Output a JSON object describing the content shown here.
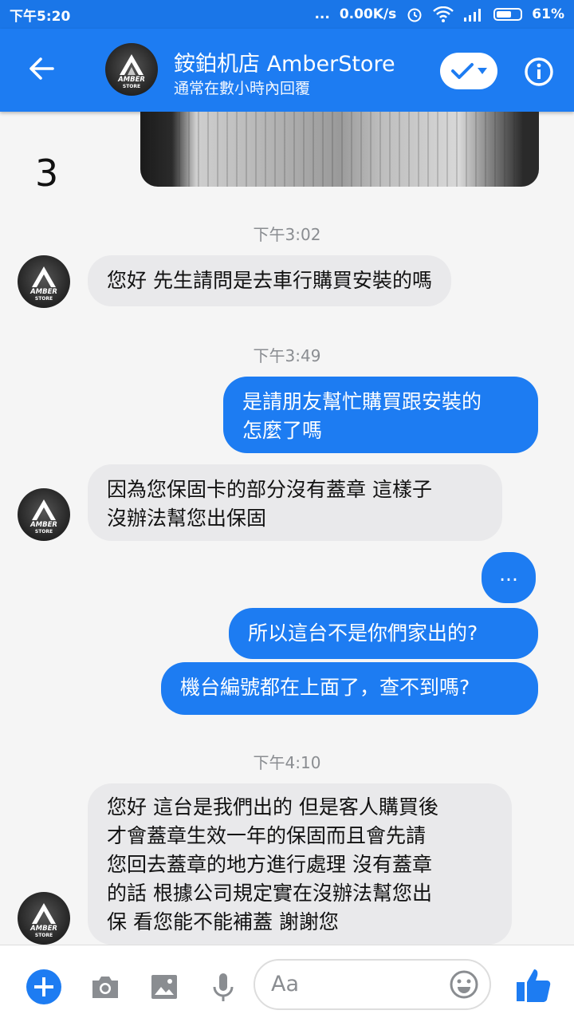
{
  "statusbar": {
    "time": "下午5:20",
    "dots": "...",
    "speed": "0.00K/s",
    "battery": "61%"
  },
  "header": {
    "title": "銨鉑机店 AmberStore",
    "subtitle": "通常在數小時內回覆"
  },
  "avatar_text": {
    "line1": "AMBER",
    "line2": "STORE"
  },
  "chat": {
    "page_marker": "3",
    "ts1": "下午3:02",
    "msg1": "您好 先生請問是去車行購買安裝的嗎",
    "ts2": "下午3:49",
    "msg2": "是請朋友幫忙購買跟安裝的\n怎麼了嗎",
    "msg3": "因為您保固卡的部分沒有蓋章 這樣子\n沒辦法幫您出保固",
    "msg4": "...",
    "msg5": "所以這台不是你們家出的?",
    "msg6": "機台編號都在上面了，查不到嗎?",
    "ts3": "下午4:10",
    "msg7": "您好 這台是我們出的 但是客人購買後\n才會蓋章生效一年的保固而且會先請\n您回去蓋章的地方進行處理 沒有蓋章\n的話 根據公司規定實在沒辦法幫您出\n保 看您能不能補蓋 謝謝您"
  },
  "composer": {
    "placeholder": "Aa"
  },
  "colors": {
    "brand": "#1d7cf2",
    "incoming": "#e9e9eb"
  }
}
